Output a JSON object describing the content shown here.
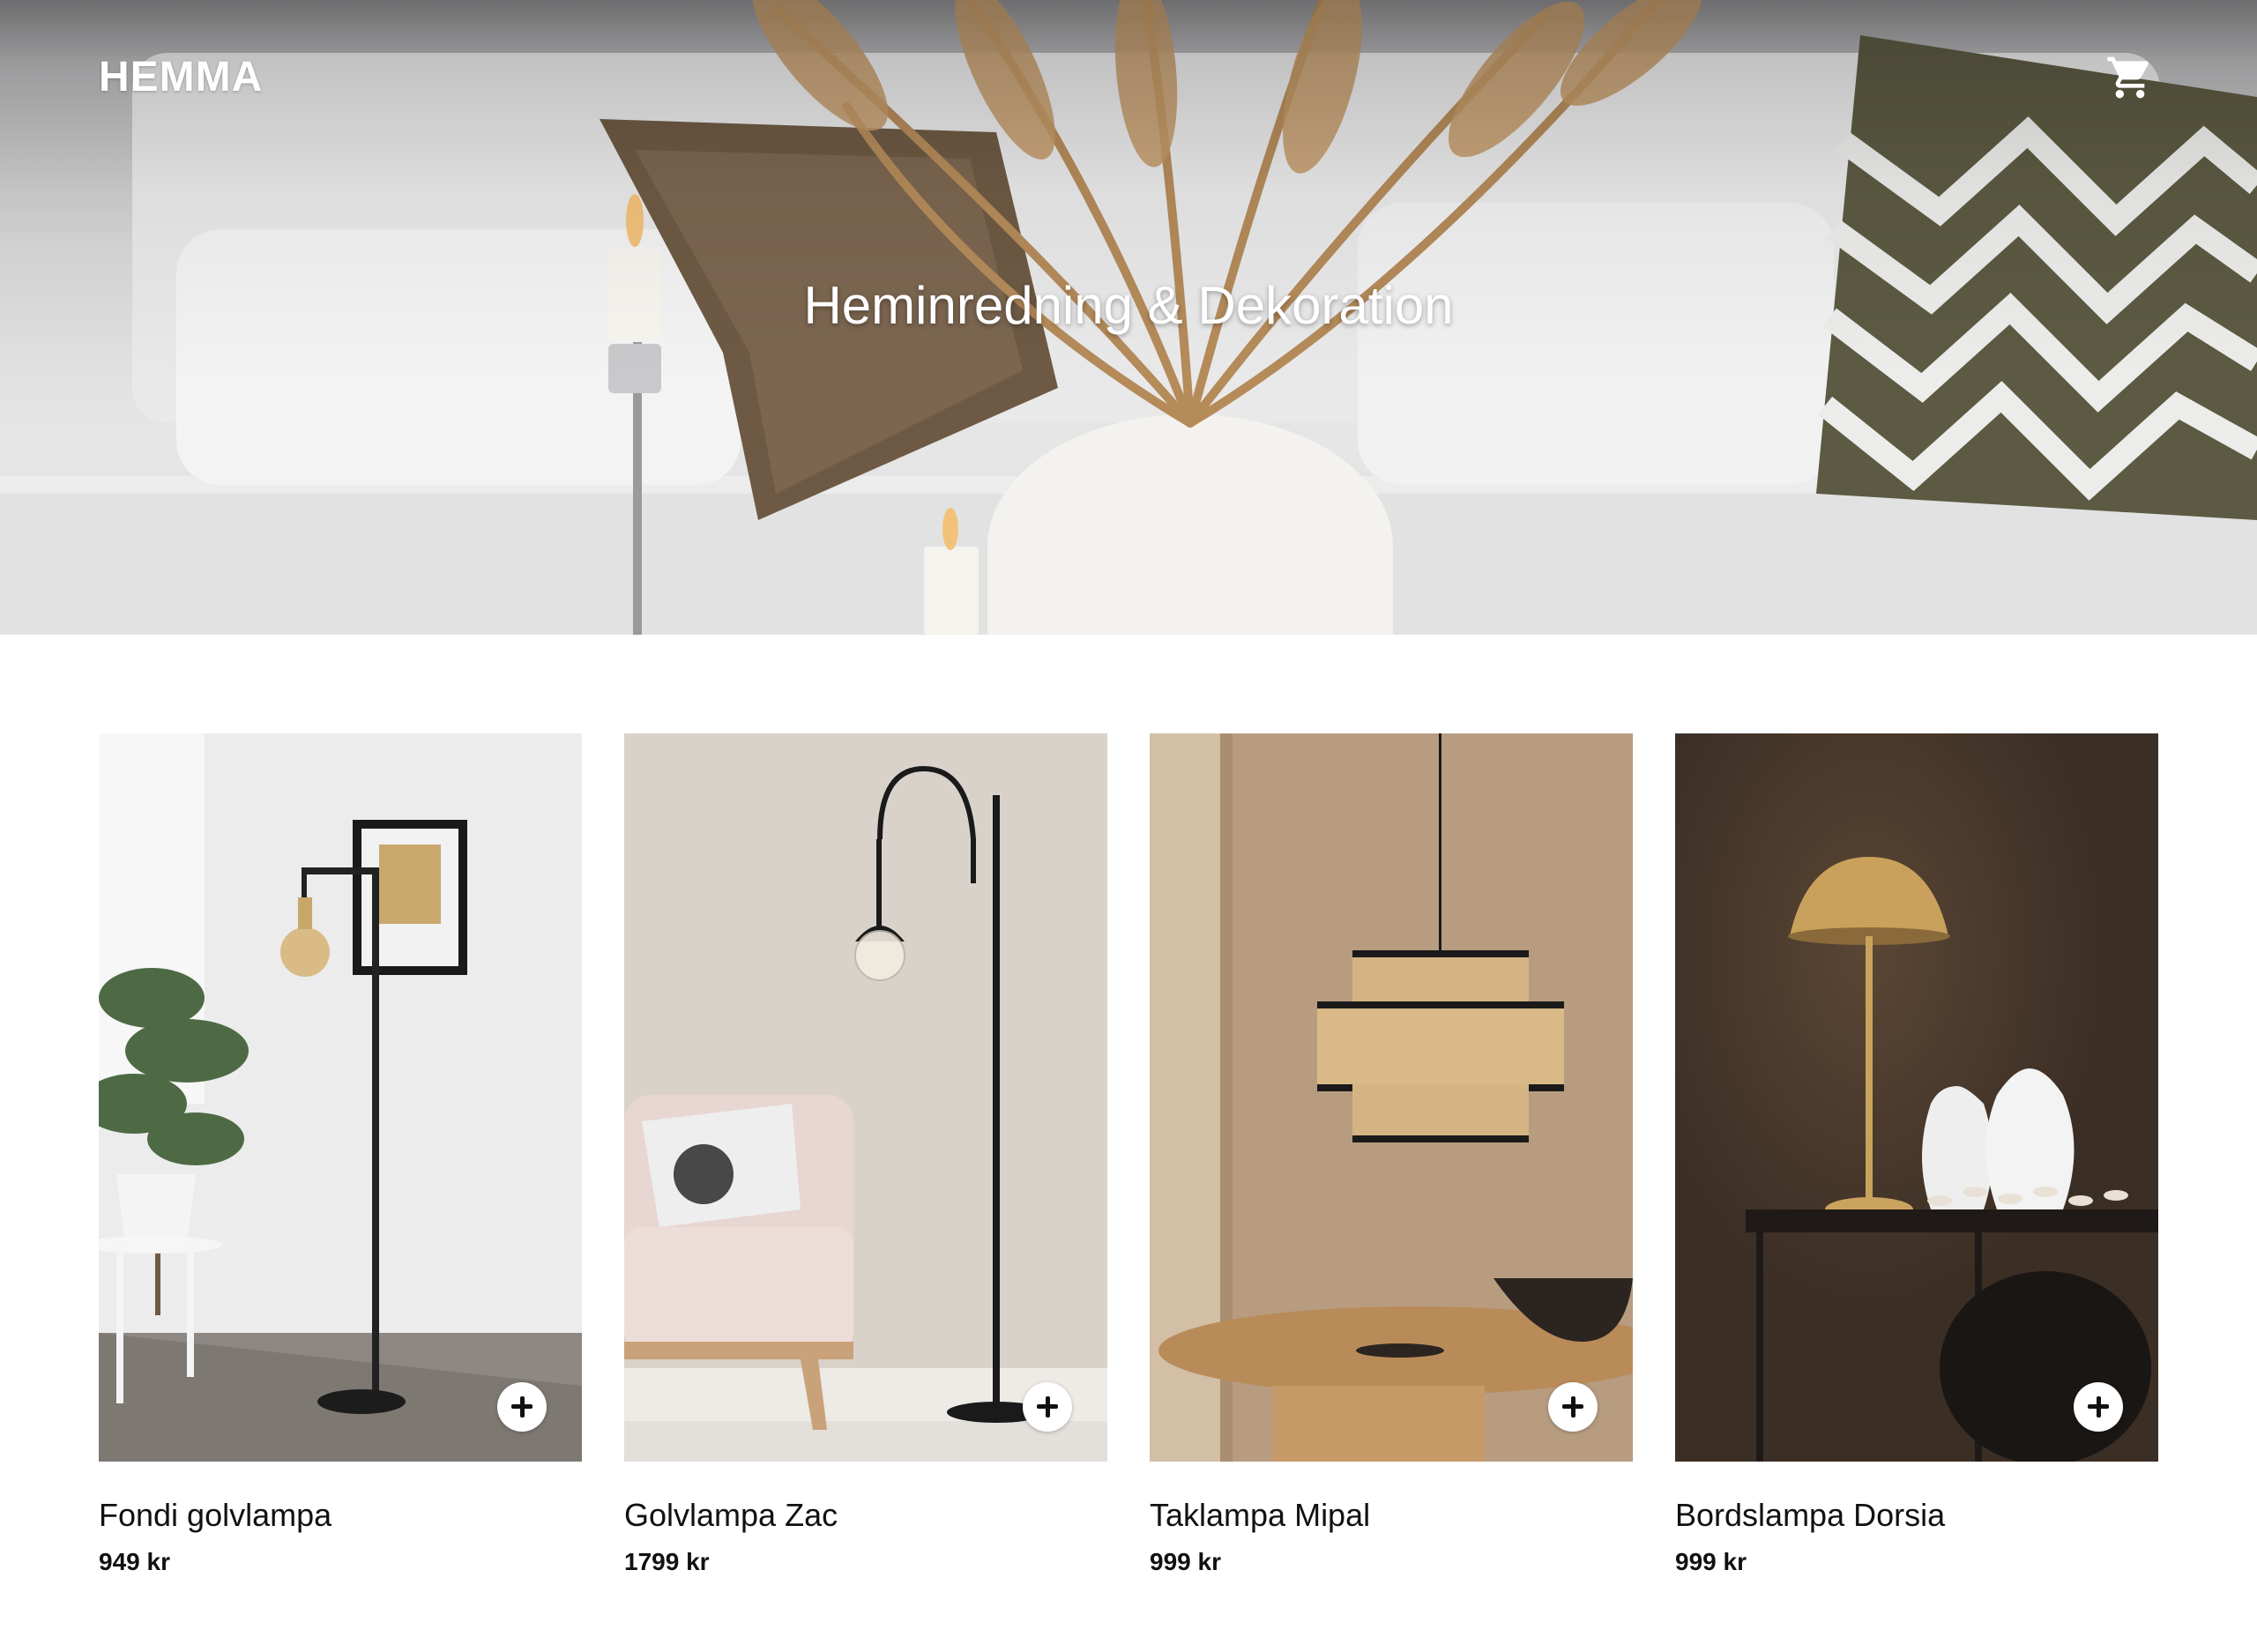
{
  "header": {
    "brand": "HEMMA",
    "cart_icon": "cart-icon"
  },
  "hero": {
    "title": "Heminredning & Dekoration"
  },
  "products": [
    {
      "name": "Fondi golvlampa",
      "price": "949 kr",
      "icon": "plus-icon"
    },
    {
      "name": "Golvlampa Zac",
      "price": "1799 kr",
      "icon": "plus-icon"
    },
    {
      "name": "Taklampa Mipal",
      "price": "999 kr",
      "icon": "plus-icon"
    },
    {
      "name": "Bordslampa Dorsia",
      "price": "999 kr",
      "icon": "plus-icon"
    }
  ]
}
